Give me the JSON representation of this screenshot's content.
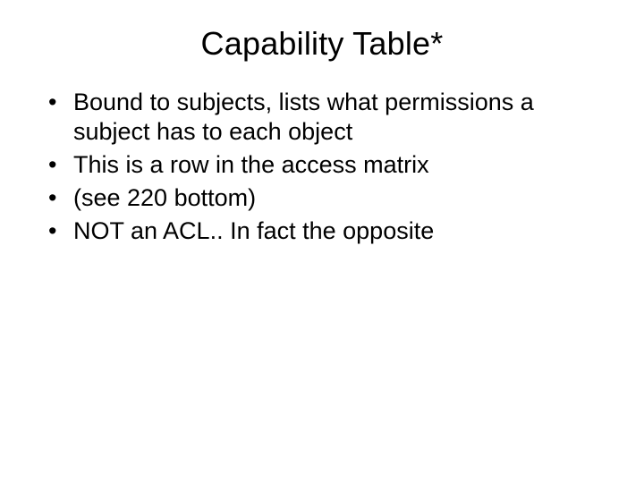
{
  "slide": {
    "title": "Capability Table*",
    "bullets": [
      "Bound to subjects, lists what permissions a subject has to each object",
      "This is a row in the access matrix",
      "(see 220 bottom)",
      "NOT an ACL.. In fact the opposite"
    ]
  }
}
